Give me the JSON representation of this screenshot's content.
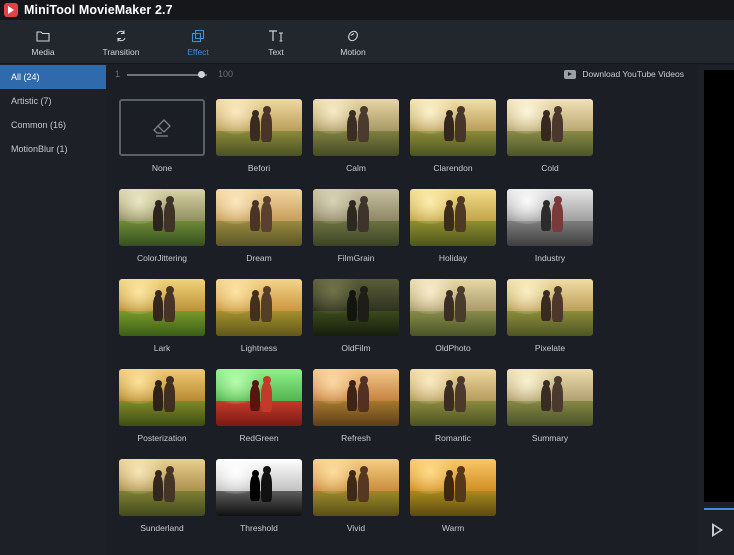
{
  "app": {
    "title": "MiniTool MovieMaker 2.7"
  },
  "toolbar": {
    "items": [
      {
        "label": "Media",
        "icon": "folder-icon"
      },
      {
        "label": "Transition",
        "icon": "transition-icon"
      },
      {
        "label": "Effect",
        "icon": "effect-icon",
        "active": true
      },
      {
        "label": "Text",
        "icon": "text-icon"
      },
      {
        "label": "Motion",
        "icon": "motion-icon"
      }
    ]
  },
  "sidebar": {
    "items": [
      {
        "label": "All (24)",
        "active": true
      },
      {
        "label": "Artistic (7)"
      },
      {
        "label": "Common (16)"
      },
      {
        "label": "MotionBlur (1)"
      }
    ]
  },
  "slider": {
    "min_label": "1",
    "max_label": "100",
    "value_fraction": 0.93
  },
  "download_link": {
    "label": "Download YouTube Videos",
    "icon": "youtube-icon"
  },
  "effects": [
    {
      "label": "None",
      "style": "none"
    },
    {
      "label": "Befori",
      "style": "warm"
    },
    {
      "label": "Calm",
      "style": "calm"
    },
    {
      "label": "Clarendon",
      "style": "clarendon"
    },
    {
      "label": "Cold",
      "style": "cold"
    },
    {
      "label": "ColorJittering",
      "style": "jitter"
    },
    {
      "label": "Dream",
      "style": "dream"
    },
    {
      "label": "FilmGrain",
      "style": "grain"
    },
    {
      "label": "Holiday",
      "style": "holiday"
    },
    {
      "label": "Industry",
      "style": "bw"
    },
    {
      "label": "Lark",
      "style": "lark"
    },
    {
      "label": "Lightness",
      "style": "light"
    },
    {
      "label": "OldFilm",
      "style": "oldfilm"
    },
    {
      "label": "OldPhoto",
      "style": "oldphoto"
    },
    {
      "label": "Pixelate",
      "style": "pixelate"
    },
    {
      "label": "Posterization",
      "style": "poster"
    },
    {
      "label": "RedGreen",
      "style": "redgreen"
    },
    {
      "label": "Refresh",
      "style": "refresh"
    },
    {
      "label": "Romantic",
      "style": "romantic"
    },
    {
      "label": "Summary",
      "style": "summary"
    },
    {
      "label": "Sunderland",
      "style": "sunderland"
    },
    {
      "label": "Threshold",
      "style": "threshold"
    },
    {
      "label": "Vivid",
      "style": "vivid"
    },
    {
      "label": "Warm",
      "style": "warmer"
    }
  ],
  "colors": {
    "accent": "#3e8ee0",
    "sidebar_active": "#2f6aad",
    "background": "#1b1e24"
  }
}
